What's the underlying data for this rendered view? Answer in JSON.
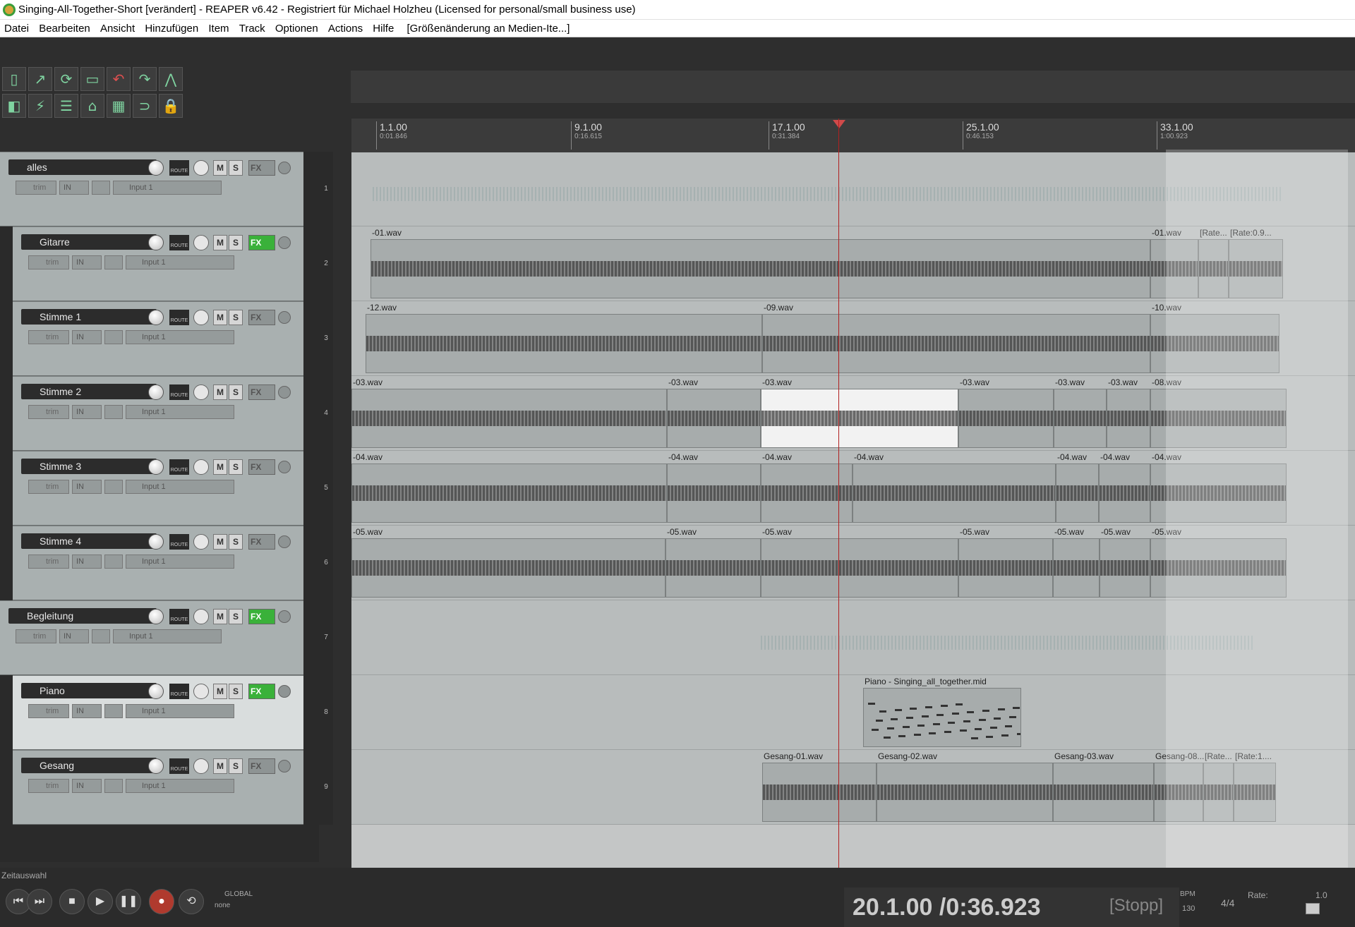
{
  "window": {
    "title": "Singing-All-Together-Short [verändert] - REAPER v6.42 - Registriert für Michael Holzheu (Licensed for personal/small business use)"
  },
  "menu": [
    "Datei",
    "Bearbeiten",
    "Ansicht",
    "Hinzufügen",
    "Item",
    "Track",
    "Optionen",
    "Actions",
    "Hilfe",
    "[Größenänderung an Medien-Ite...]"
  ],
  "ruler": {
    "marks": [
      {
        "bar": "1.1.00",
        "time": "0:01.846"
      },
      {
        "bar": "9.1.00",
        "time": "0:16.615"
      },
      {
        "bar": "17.1.00",
        "time": "0:31.384"
      },
      {
        "bar": "25.1.00",
        "time": "0:46.153"
      },
      {
        "bar": "33.1.00",
        "time": "1:00.923"
      }
    ]
  },
  "tracks": [
    {
      "name": "alles",
      "num": "1",
      "fx_on": false,
      "folder": true
    },
    {
      "name": "Gitarre",
      "num": "2",
      "fx_on": true
    },
    {
      "name": "Stimme 1",
      "num": "3",
      "fx_on": false
    },
    {
      "name": "Stimme 2",
      "num": "4",
      "fx_on": false
    },
    {
      "name": "Stimme 3",
      "num": "5",
      "fx_on": false
    },
    {
      "name": "Stimme 4",
      "num": "6",
      "fx_on": false
    },
    {
      "name": "Begleitung",
      "num": "7",
      "fx_on": true,
      "folder": true
    },
    {
      "name": "Piano",
      "num": "8",
      "fx_on": true
    },
    {
      "name": "Gesang",
      "num": "9",
      "fx_on": false
    }
  ],
  "labels": {
    "trim": "trim",
    "in": "IN",
    "input": "Input 1",
    "route": "ROUTE",
    "m": "M",
    "s": "S",
    "fx": "FX"
  },
  "items": {
    "gitarre": [
      "-01.wav",
      "-01.wav",
      "[Rate...",
      "[Rate:0.9..."
    ],
    "stimme1": [
      "-12.wav",
      "-09.wav",
      "-10.wav"
    ],
    "stimme2": [
      "-03.wav",
      "-03.wav",
      "-03.wav",
      "-03.wav",
      "-03.wav",
      "-03.wav",
      "-08.wav"
    ],
    "stimme3": [
      "-04.wav",
      "-04.wav",
      "-04.wav",
      "-04.wav",
      "-04.wav",
      "-04.wav",
      "-04.wav"
    ],
    "stimme4": [
      "-05.wav",
      "-05.wav",
      "-05.wav",
      "-05.wav",
      "-05.wav",
      "-05.wav",
      "-05.wav"
    ],
    "piano": [
      "Piano - Singing_all_together.mid"
    ],
    "gesang": [
      "Gesang-01.wav",
      "Gesang-02.wav",
      "Gesang-03.wav",
      "Gesang-08...",
      "[Rate...",
      "[Rate:1...."
    ]
  },
  "transport": {
    "status_label": "Zeitauswahl",
    "position": "20.1.00 /0:36.923",
    "state": "[Stopp]",
    "bpm_label": "BPM",
    "bpm": "130",
    "signature": "4/4",
    "rate_label": "Rate:",
    "rate": "1.0",
    "global_label": "GLOBAL",
    "global_value": "none"
  }
}
